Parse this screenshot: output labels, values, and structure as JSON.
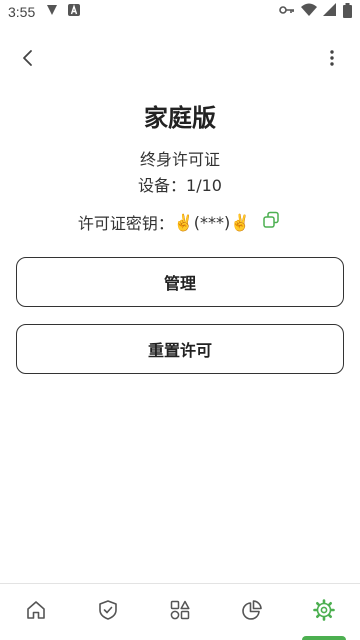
{
  "status_bar": {
    "time": "3:55",
    "left_icons": [
      "shield-icon",
      "a-letter-icon"
    ],
    "right_icons": [
      "key-icon",
      "wifi-icon",
      "signal-icon",
      "battery-icon"
    ]
  },
  "top_bar": {
    "back_icon": "chevron-left-icon",
    "more_icon": "more-vert-icon"
  },
  "plan": {
    "title": "家庭版",
    "type": "终身许可证",
    "devices_label": "设备：",
    "devices_value": "1/10",
    "license_label": "许可证密钥：",
    "license_value": "✌️(***)✌️",
    "copy_icon": "copy-icon"
  },
  "buttons": {
    "manage": "管理",
    "reset": "重置许可"
  },
  "bottom_nav": {
    "items": [
      {
        "icon": "home-icon"
      },
      {
        "icon": "shield-check-icon"
      },
      {
        "icon": "shapes-icon"
      },
      {
        "icon": "pie-chart-icon"
      },
      {
        "icon": "settings-icon",
        "active": true
      }
    ]
  },
  "colors": {
    "accent": "#4caf50",
    "icon": "#555555",
    "text": "#222222"
  }
}
